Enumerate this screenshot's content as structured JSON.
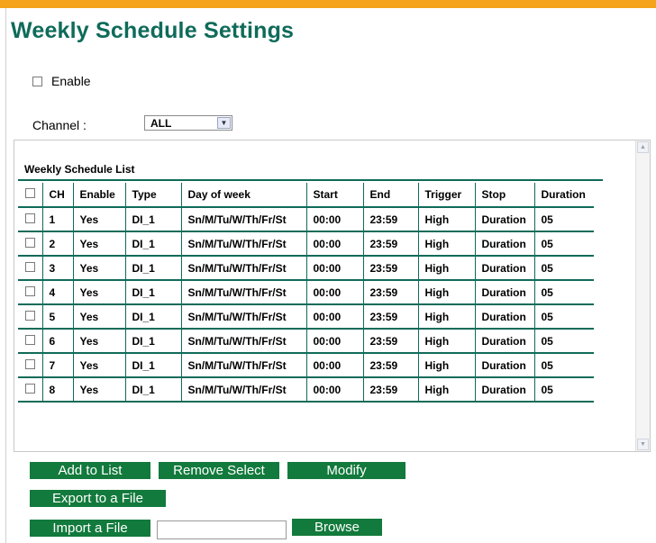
{
  "page": {
    "title": "Weekly Schedule Settings"
  },
  "enable": {
    "label": "Enable",
    "checked": false
  },
  "channel": {
    "label": "Channel :",
    "value": "ALL"
  },
  "list": {
    "title": "Weekly Schedule List",
    "headers": [
      "CH",
      "Enable",
      "Type",
      "Day of week",
      "Start",
      "End",
      "Trigger",
      "Stop",
      "Duration"
    ],
    "rows": [
      [
        "1",
        "Yes",
        "DI_1",
        "Sn/M/Tu/W/Th/Fr/St",
        "00:00",
        "23:59",
        "High",
        "Duration",
        "05"
      ],
      [
        "2",
        "Yes",
        "DI_1",
        "Sn/M/Tu/W/Th/Fr/St",
        "00:00",
        "23:59",
        "High",
        "Duration",
        "05"
      ],
      [
        "3",
        "Yes",
        "DI_1",
        "Sn/M/Tu/W/Th/Fr/St",
        "00:00",
        "23:59",
        "High",
        "Duration",
        "05"
      ],
      [
        "4",
        "Yes",
        "DI_1",
        "Sn/M/Tu/W/Th/Fr/St",
        "00:00",
        "23:59",
        "High",
        "Duration",
        "05"
      ],
      [
        "5",
        "Yes",
        "DI_1",
        "Sn/M/Tu/W/Th/Fr/St",
        "00:00",
        "23:59",
        "High",
        "Duration",
        "05"
      ],
      [
        "6",
        "Yes",
        "DI_1",
        "Sn/M/Tu/W/Th/Fr/St",
        "00:00",
        "23:59",
        "High",
        "Duration",
        "05"
      ],
      [
        "7",
        "Yes",
        "DI_1",
        "Sn/M/Tu/W/Th/Fr/St",
        "00:00",
        "23:59",
        "High",
        "Duration",
        "05"
      ],
      [
        "8",
        "Yes",
        "DI_1",
        "Sn/M/Tu/W/Th/Fr/St",
        "00:00",
        "23:59",
        "High",
        "Duration",
        "05"
      ]
    ]
  },
  "buttons": {
    "add": "Add to List",
    "remove": "Remove Select",
    "modify": "Modify",
    "export": "Export to a File",
    "import": "Import a File",
    "browse": "Browse"
  },
  "import_file": {
    "value": ""
  },
  "colors": {
    "accent_bar": "#f5a31a",
    "title": "#0f6b5a",
    "button": "#127a3c"
  }
}
